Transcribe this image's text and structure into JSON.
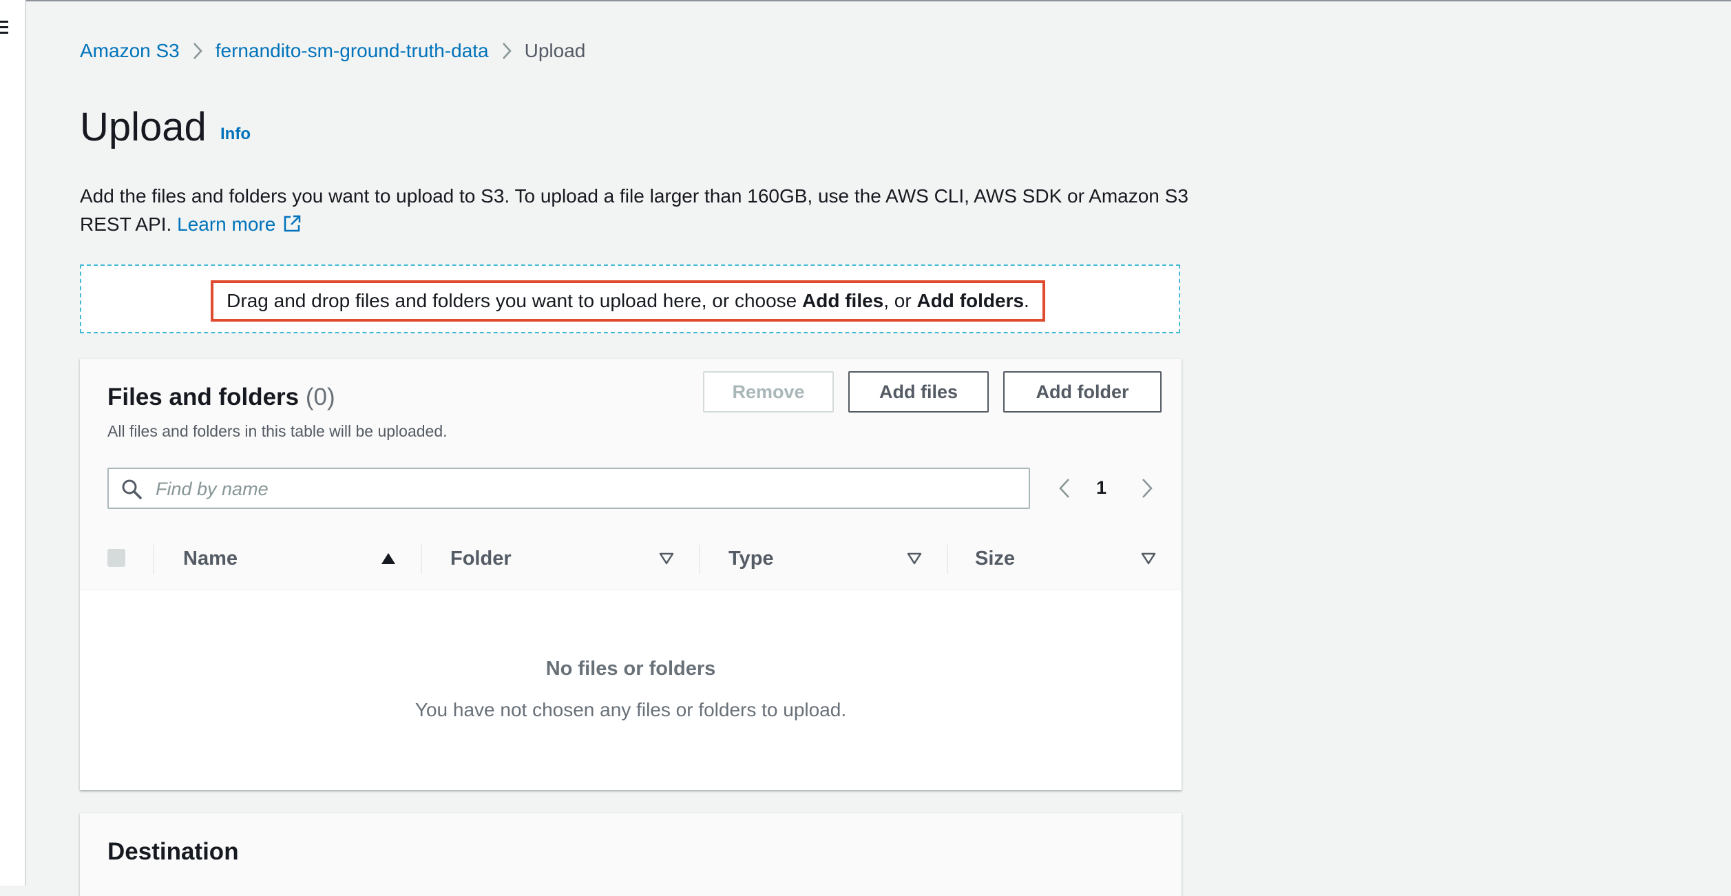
{
  "breadcrumb": {
    "items": [
      {
        "label": "Amazon S3"
      },
      {
        "label": "fernandito-sm-ground-truth-data"
      },
      {
        "label": "Upload"
      }
    ]
  },
  "header": {
    "title": "Upload",
    "info_label": "Info"
  },
  "description": {
    "text": "Add the files and folders you want to upload to S3. To upload a file larger than 160GB, use the AWS CLI, AWS SDK or Amazon S3 REST API.",
    "learn_more": "Learn more"
  },
  "dropzone": {
    "prefix": "Drag and drop files and folders you want to upload here, or choose ",
    "add_files": "Add files",
    "middle": ", or ",
    "add_folders": "Add folders",
    "suffix": "."
  },
  "files_panel": {
    "title": "Files and folders",
    "count": "(0)",
    "subtitle": "All files and folders in this table will be uploaded.",
    "remove_label": "Remove",
    "add_files_label": "Add files",
    "add_folder_label": "Add folder",
    "search_placeholder": "Find by name",
    "page_number": "1",
    "columns": [
      {
        "label": "Name",
        "sort": "ascending"
      },
      {
        "label": "Folder",
        "sort": "none"
      },
      {
        "label": "Type",
        "sort": "none"
      },
      {
        "label": "Size",
        "sort": "none"
      }
    ],
    "empty_title": "No files or folders",
    "empty_subtitle": "You have not chosen any files or folders to upload."
  },
  "destination": {
    "title": "Destination"
  },
  "colors": {
    "link": "#0073bb",
    "highlight_border": "#e04a2e",
    "dropzone_border": "#44b9d6",
    "text": "#16191f",
    "muted": "#687078"
  },
  "icons": {
    "breadcrumb_separator": "chevron-right-icon",
    "external_link": "external-link-icon",
    "search": "search-icon",
    "sort_ascending": "caret-up-filled-icon",
    "sort_none": "caret-down-outline-icon",
    "menu": "hamburger-icon"
  }
}
